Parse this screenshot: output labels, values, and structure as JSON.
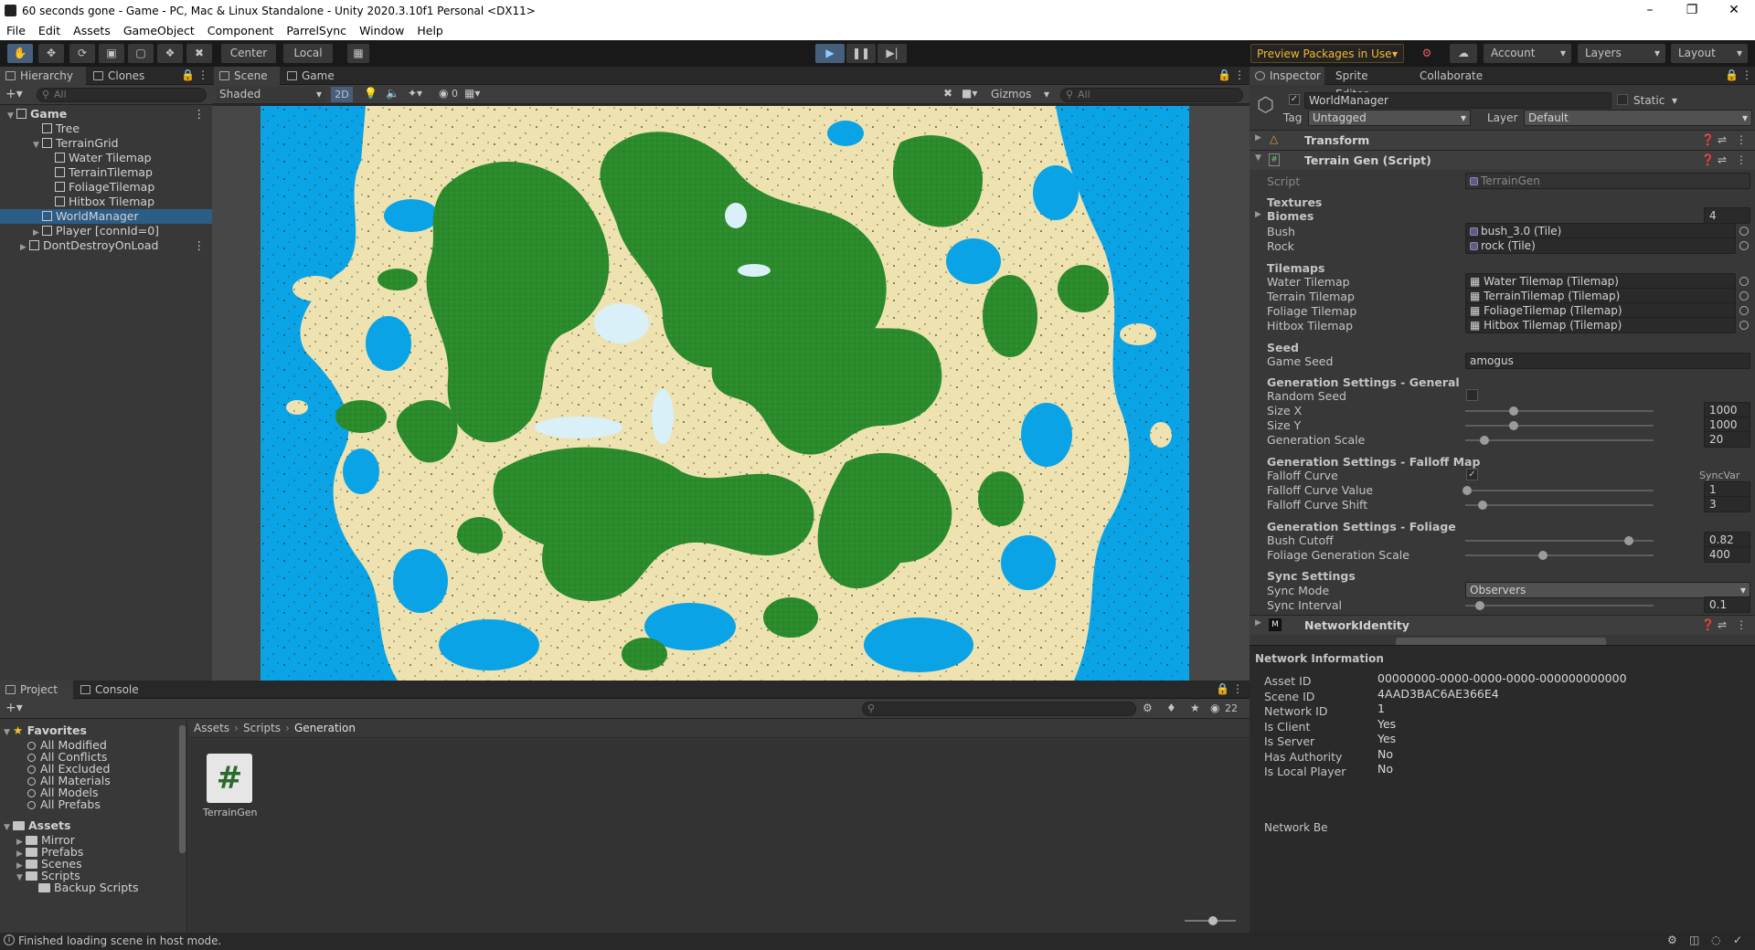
{
  "window": {
    "title": "60 seconds gone - Game - PC, Mac & Linux Standalone - Unity 2020.3.10f1 Personal <DX11>"
  },
  "menu": [
    "File",
    "Edit",
    "Assets",
    "GameObject",
    "Component",
    "ParrelSync",
    "Window",
    "Help"
  ],
  "toolbar": {
    "center": "Center",
    "local": "Local",
    "preview_packages": "Preview Packages in Use",
    "account": "Account",
    "layers": "Layers",
    "layout": "Layout"
  },
  "hierarchy": {
    "tabs": [
      "Hierarchy",
      "Clones Mana"
    ],
    "search_placeholder": "All",
    "rows": [
      {
        "label": "Game",
        "indent": 0,
        "arrow": "▼",
        "bold": true
      },
      {
        "label": "Tree",
        "indent": 2,
        "arrow": ""
      },
      {
        "label": "TerrainGrid",
        "indent": 2,
        "arrow": "▼"
      },
      {
        "label": "Water Tilemap",
        "indent": 3,
        "arrow": ""
      },
      {
        "label": "TerrainTilemap",
        "indent": 3,
        "arrow": ""
      },
      {
        "label": "FoliageTilemap",
        "indent": 3,
        "arrow": ""
      },
      {
        "label": "Hitbox Tilemap",
        "indent": 3,
        "arrow": ""
      },
      {
        "label": "WorldManager",
        "indent": 2,
        "arrow": "",
        "selected": true
      },
      {
        "label": "Player [connId=0]",
        "indent": 2,
        "arrow": "▶"
      },
      {
        "label": "DontDestroyOnLoad",
        "indent": 1,
        "arrow": "▶"
      }
    ]
  },
  "scene": {
    "tabs": [
      "Scene",
      "Game"
    ],
    "shading": "Shaded",
    "mode_2d": "2D",
    "hidden_count": "0",
    "gizmos": "Gizmos",
    "search_placeholder": "All"
  },
  "inspector": {
    "tabs": [
      "Inspector",
      "Sprite Editor",
      "Collaborate"
    ],
    "object_name": "WorldManager",
    "static_label": "Static",
    "tag_label": "Tag",
    "tag_value": "Untagged",
    "layer_label": "Layer",
    "layer_value": "Default",
    "components": {
      "transform": "Transform",
      "terrain_gen": "Terrain Gen (Script)",
      "network_identity": "NetworkIdentity"
    },
    "script_label": "Script",
    "script_value": "TerrainGen",
    "textures_header": "Textures",
    "biomes_label": "Biomes",
    "biomes_count": "4",
    "bush_label": "Bush",
    "bush_value": "bush_3.0 (Tile)",
    "rock_label": "Rock",
    "rock_value": "rock (Tile)",
    "tilemaps_header": "Tilemaps",
    "water_label": "Water Tilemap",
    "water_value": "Water Tilemap (Tilemap)",
    "terrain_label": "Terrain Tilemap",
    "terrain_value": "TerrainTilemap (Tilemap)",
    "foliage_label": "Foliage Tilemap",
    "foliage_value": "FoliageTilemap (Tilemap)",
    "hitbox_label": "Hitbox Tilemap",
    "hitbox_value": "Hitbox Tilemap (Tilemap)",
    "seed_header": "Seed",
    "game_seed_label": "Game Seed",
    "game_seed_value": "amogus",
    "gen_general_header": "Generation Settings - General",
    "random_seed_label": "Random Seed",
    "size_x_label": "Size X",
    "size_x_value": "1000",
    "size_y_label": "Size Y",
    "size_y_value": "1000",
    "gen_scale_label": "Generation Scale",
    "gen_scale_value": "20",
    "gen_falloff_header": "Generation Settings - Falloff Map",
    "falloff_curve_label": "Falloff Curve",
    "syncvar_label": "SyncVar",
    "falloff_value_label": "Falloff Curve Value",
    "falloff_value_value": "1",
    "falloff_shift_label": "Falloff Curve Shift",
    "falloff_shift_value": "3",
    "gen_foliage_header": "Generation Settings - Foliage",
    "bush_cutoff_label": "Bush Cutoff",
    "bush_cutoff_value": "0.82",
    "foliage_scale_label": "Foliage Generation Scale",
    "foliage_scale_value": "400",
    "sync_header": "Sync Settings",
    "sync_mode_label": "Sync Mode",
    "sync_mode_value": "Observers",
    "sync_interval_label": "Sync Interval",
    "sync_interval_value": "0.1",
    "network_info_header": "Network Information",
    "network": [
      {
        "label": "Asset ID",
        "value": "00000000-0000-0000-0000-000000000000"
      },
      {
        "label": "Scene ID",
        "value": "4AAD3BAC6AE366E4"
      },
      {
        "label": "Network ID",
        "value": "1"
      },
      {
        "label": "Is Client",
        "value": "Yes"
      },
      {
        "label": "Is Server",
        "value": "Yes"
      },
      {
        "label": "Has Authority",
        "value": "No"
      },
      {
        "label": "Is Local Player",
        "value": "No"
      }
    ],
    "network_be": "Network Be"
  },
  "project": {
    "tabs": [
      "Project",
      "Console"
    ],
    "hidden_count": "22",
    "breadcrumb": [
      "Assets",
      "Scripts",
      "Generation"
    ],
    "favorites_header": "Favorites",
    "favorites": [
      "All Modified",
      "All Conflicts",
      "All Excluded",
      "All Materials",
      "All Models",
      "All Prefabs"
    ],
    "assets_header": "Assets",
    "assets": [
      {
        "label": "Mirror",
        "indent": 1
      },
      {
        "label": "Prefabs",
        "indent": 1
      },
      {
        "label": "Scenes",
        "indent": 1
      },
      {
        "label": "Scripts",
        "indent": 1
      },
      {
        "label": "Backup Scripts",
        "indent": 2
      }
    ],
    "file_label": "TerrainGen",
    "file_glyph": "#"
  },
  "status": {
    "message": "Finished loading scene in host mode."
  }
}
